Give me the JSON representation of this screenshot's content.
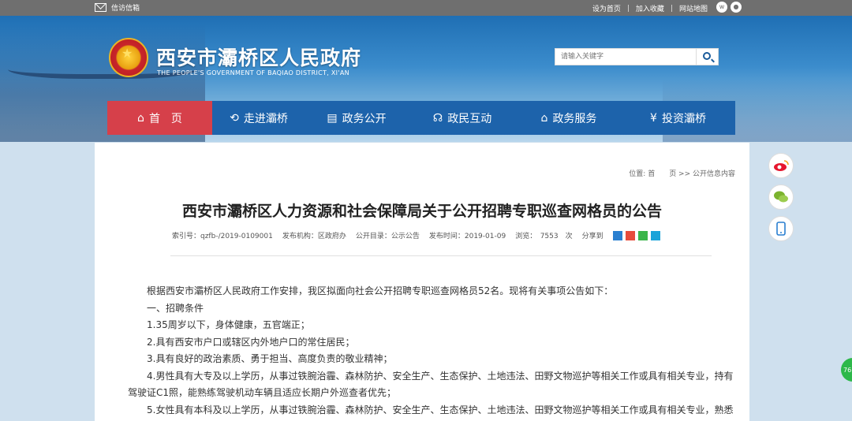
{
  "topbar": {
    "mail_label": "信访信箱",
    "links": [
      "设为首页",
      "加入收藏",
      "网站地图"
    ],
    "separator": "|"
  },
  "header": {
    "title": "西安市灞桥区人民政府",
    "subtitle": "THE PEOPLE'S GOVERNMENT OF BAQIAO DISTRICT, XI'AN",
    "search_placeholder": "请输入关键字"
  },
  "nav": {
    "items": [
      {
        "label": "首　页",
        "icon": "home-icon"
      },
      {
        "label": "走进灞桥",
        "icon": "enter-icon"
      },
      {
        "label": "政务公开",
        "icon": "document-icon"
      },
      {
        "label": "政民互动",
        "icon": "chat-icon"
      },
      {
        "label": "政务服务",
        "icon": "building-icon"
      },
      {
        "label": "投资灞桥",
        "icon": "yen-icon"
      }
    ]
  },
  "content": {
    "breadcrumb": "位置: 首　　页 >> 公开信息内容",
    "title": "西安市灞桥区人力资源和社会保障局关于公开招聘专职巡查网格员的公告",
    "meta": {
      "index": "索引号：qzfb-/2019-0109001",
      "org": "发布机构：区政府办",
      "catalog": "公开目录：公示公告",
      "time": "发布时间：2019-01-09",
      "views": "浏览：　7553　次",
      "share": "分享到"
    },
    "paragraphs": [
      "　　根据西安市灞桥区人民政府工作安排，我区拟面向社会公开招聘专职巡查网格员52名。现将有关事项公告如下：",
      "　　一、招聘条件",
      "　　1.35周岁以下，身体健康，五官端正；",
      "　　2.具有西安市户口或辖区内外地户口的常住居民；",
      "　　3.具有良好的政治素质、勇于担当、高度负责的敬业精神；",
      "　　4.男性具有大专及以上学历，从事过铁腕治霾、森林防护、安全生产、生态保护、土地违法、田野文物巡护等相关工作或具有相关专业，持有驾驶证C1照，能熟练驾驶机动车辆且适应长期户外巡查者优先；",
      "　　5.女性具有本科及以上学历，从事过铁腕治霾、森林防护、安全生产、生态保护、土地违法、田野文物巡护等相关工作或具有相关专业，熟悉"
    ]
  },
  "badge": "76",
  "colors": {
    "nav_bg": "#1d63ab",
    "home_bg": "#d6404a",
    "topbar_bg": "#6f6f6f"
  }
}
